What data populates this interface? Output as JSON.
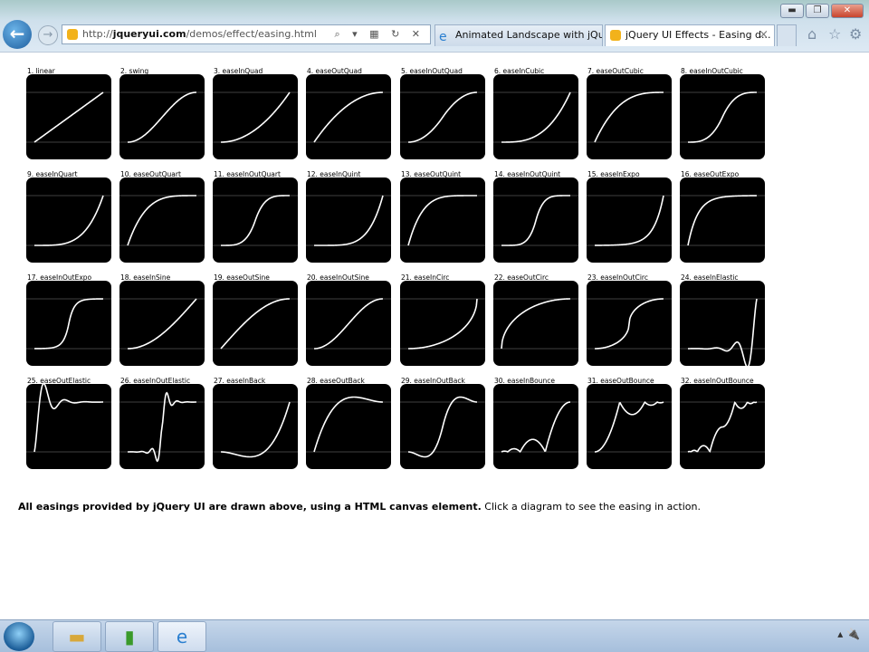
{
  "browser": {
    "url_prefix": "http://",
    "url_domain": "jqueryui.com",
    "url_path": "/demos/effect/easing.html",
    "address_tools": "⌕ ▾ ▦ ↻ ✕",
    "tabs": [
      {
        "label": "Animated Landscape with jQu...",
        "active": false
      },
      {
        "label": "jQuery UI Effects - Easing d...",
        "active": true
      }
    ],
    "tab_close": "×",
    "window_buttons": {
      "minimize": "▬",
      "restore": "❐",
      "close": "✕"
    },
    "toolbar_icons": {
      "home": "⌂",
      "favorites": "☆",
      "tools": "⚙"
    }
  },
  "easings": [
    "1. linear",
    "2. swing",
    "3. easeInQuad",
    "4. easeOutQuad",
    "5. easeInOutQuad",
    "6. easeInCubic",
    "7. easeOutCubic",
    "8. easeInOutCubic",
    "9. easeInQuart",
    "10. easeOutQuart",
    "11. easeInOutQuart",
    "12. easeInQuint",
    "13. easeOutQuint",
    "14. easeInOutQuint",
    "15. easeInExpo",
    "16. easeOutExpo",
    "17. easeInOutExpo",
    "18. easeInSine",
    "19. easeOutSine",
    "20. easeInOutSine",
    "21. easeInCirc",
    "22. easeOutCirc",
    "23. easeInOutCirc",
    "24. easeInElastic",
    "25. easeOutElastic",
    "26. easeInOutElastic",
    "27. easeInBack",
    "28. easeOutBack",
    "29. easeInOutBack",
    "30. easeInBounce",
    "31. easeOutBounce",
    "32. easeInOutBounce"
  ],
  "colors": {
    "canvas_bg": "#000000",
    "curve": "#ffffff",
    "guide": "#555555"
  },
  "description": {
    "bold": "All easings provided by jQuery UI are drawn above, using a HTML canvas element.",
    "normal": " Click a diagram to see the easing in action."
  },
  "taskbar": {
    "apps": [
      "explorer",
      "notepad-chart",
      "internet-explorer"
    ],
    "tray": "▴ 🔌"
  }
}
